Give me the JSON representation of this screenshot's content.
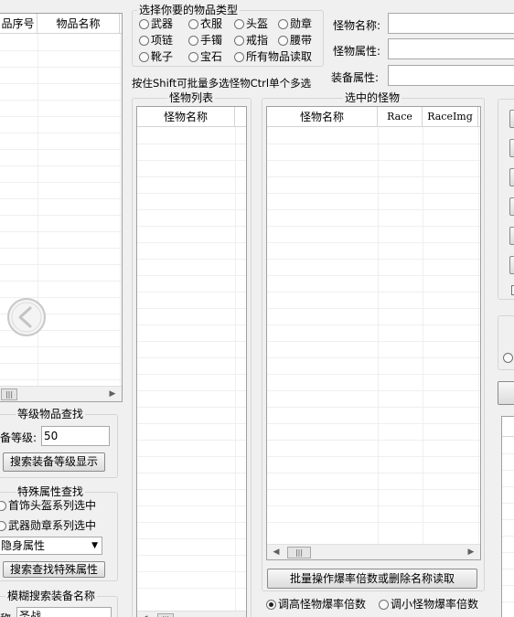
{
  "left_table": {
    "columns": [
      "品序号",
      "物品名称"
    ]
  },
  "back_button": {
    "icon": "chevron-left-icon"
  },
  "level_search": {
    "title": "等级物品查找",
    "level_label": "备等级:",
    "level_value": "50",
    "search_button": "搜索装备等级显示"
  },
  "special_search": {
    "title": "特殊属性查找",
    "radio_helmet": "首饰头盔系列选中",
    "radio_weapon": "武器勋章系列选中",
    "attr_select": "隐身属性",
    "search_button": "搜索查找特殊属性"
  },
  "fuzzy_search": {
    "title": "模糊搜索装备名称",
    "label": "称",
    "value": "圣战"
  },
  "item_type": {
    "title": "选择你要的物品类型",
    "options": [
      "武器",
      "衣服",
      "头盔",
      "勋章",
      "项链",
      "手镯",
      "戒指",
      "腰带",
      "靴子",
      "宝石",
      "所有物品读取"
    ]
  },
  "hint": "按住Shift可批量多选怪物Ctrl单个多选",
  "monster_info": {
    "name_label": "怪物名称:",
    "name_value": "",
    "attr_label": "怪物属性:",
    "attr_value": "",
    "equip_label": "装备属性:",
    "equip_value": ""
  },
  "monster_list": {
    "title": "怪物列表",
    "columns": [
      "怪物名称"
    ]
  },
  "selected_monsters": {
    "title": "选中的怪物",
    "columns": [
      "怪物名称",
      "Race",
      "RaceImg"
    ]
  },
  "batch_button": "批量操作爆率倍数或删除名称读取",
  "rate_options": [
    "调高怪物爆率倍数",
    "调小怪物爆率倍数"
  ],
  "rate_selected": "调高怪物爆率倍数"
}
